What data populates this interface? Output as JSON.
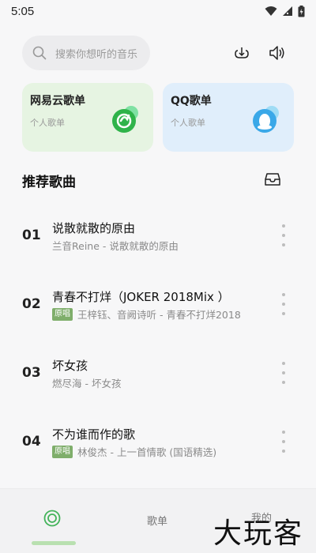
{
  "status": {
    "time": "5:05"
  },
  "search": {
    "placeholder": "搜索你想听的音乐"
  },
  "cards": [
    {
      "title": "网易云歌单",
      "subtitle": "个人歌单"
    },
    {
      "title": "QQ歌单",
      "subtitle": "个人歌单"
    }
  ],
  "section": {
    "title": "推荐歌曲"
  },
  "songs": [
    {
      "num": "01",
      "title": "说散就散的原由",
      "badge": "",
      "subtitle": "兰音Reine - 说散就散的原由"
    },
    {
      "num": "02",
      "title": "青春不打烊（JOKER 2018Mix ）",
      "badge": "原唱",
      "subtitle": "王梓钰、音阙诗听 - 青春不打烊2018"
    },
    {
      "num": "03",
      "title": "坏女孩",
      "badge": "",
      "subtitle": "燃尽海 - 坏女孩"
    },
    {
      "num": "04",
      "title": "不为谁而作的歌",
      "badge": "原唱",
      "subtitle": "林俊杰 - 上一首情歌 (国语精选)"
    }
  ],
  "nav": {
    "playlist": "歌单",
    "mine": "我的"
  },
  "watermark": "大玩客",
  "colors": {
    "green": "#2fb34a",
    "qq_blue": "#3aa8e8",
    "badge": "#7fae6b"
  }
}
